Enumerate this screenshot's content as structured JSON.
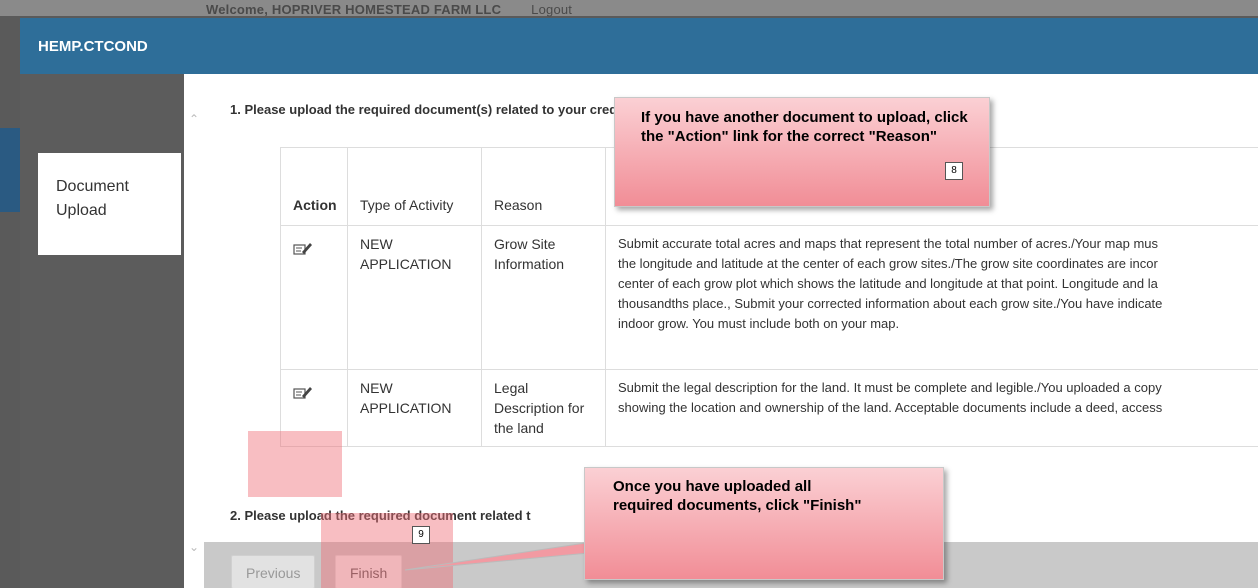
{
  "background": {
    "welcome_text": "Welcome, HOPRIVER HOMESTEAD FARM LLC",
    "logout_text": "Logout"
  },
  "modal": {
    "title": "HEMP.CTCOND"
  },
  "sidebar": {
    "items": [
      {
        "label": "Document Upload",
        "selected": true
      }
    ]
  },
  "content": {
    "question1": "1. Please upload the required document(s) related to your credential",
    "question2": "2. Please upload the required document related t",
    "table": {
      "headers": [
        "Action",
        "Type of Activity",
        "Reason",
        ""
      ],
      "rows": [
        {
          "action_icon": "edit-icon",
          "type": "NEW APPLICATION",
          "reason": "Grow Site Information",
          "description_lines": [
            "Submit accurate total acres and maps that represent the total number of acres./Your map mus",
            "the longitude and latitude at the center of each grow sites./The grow site coordinates are incor",
            "center of each grow plot which shows the latitude and longitude at that point. Longitude and la",
            "thousandths place., Submit your corrected information about each grow site./You have indicate",
            "indoor grow. You must include both on your map."
          ]
        },
        {
          "action_icon": "edit-icon",
          "type": "NEW APPLICATION",
          "reason": "Legal Description for the land",
          "description_lines": [
            "Submit the legal description for the land. It must be complete and legible./You uploaded a copy",
            "showing the location and ownership of the land. Acceptable documents include a deed, access"
          ]
        }
      ]
    }
  },
  "footer": {
    "previous_label": "Previous",
    "finish_label": "Finish"
  },
  "callouts": [
    {
      "text": "If you have another document to upload, click the \"Action\" link for the correct \"Reason\"",
      "badge": "8"
    },
    {
      "text": "Once you have uploaded all required documents, click \"Finish\"",
      "badge": "9"
    }
  ],
  "colors": {
    "header": "#2e6e99",
    "highlight": "#f06e78",
    "callout_top": "#fbd0d4",
    "callout_bottom": "#f18d96"
  }
}
